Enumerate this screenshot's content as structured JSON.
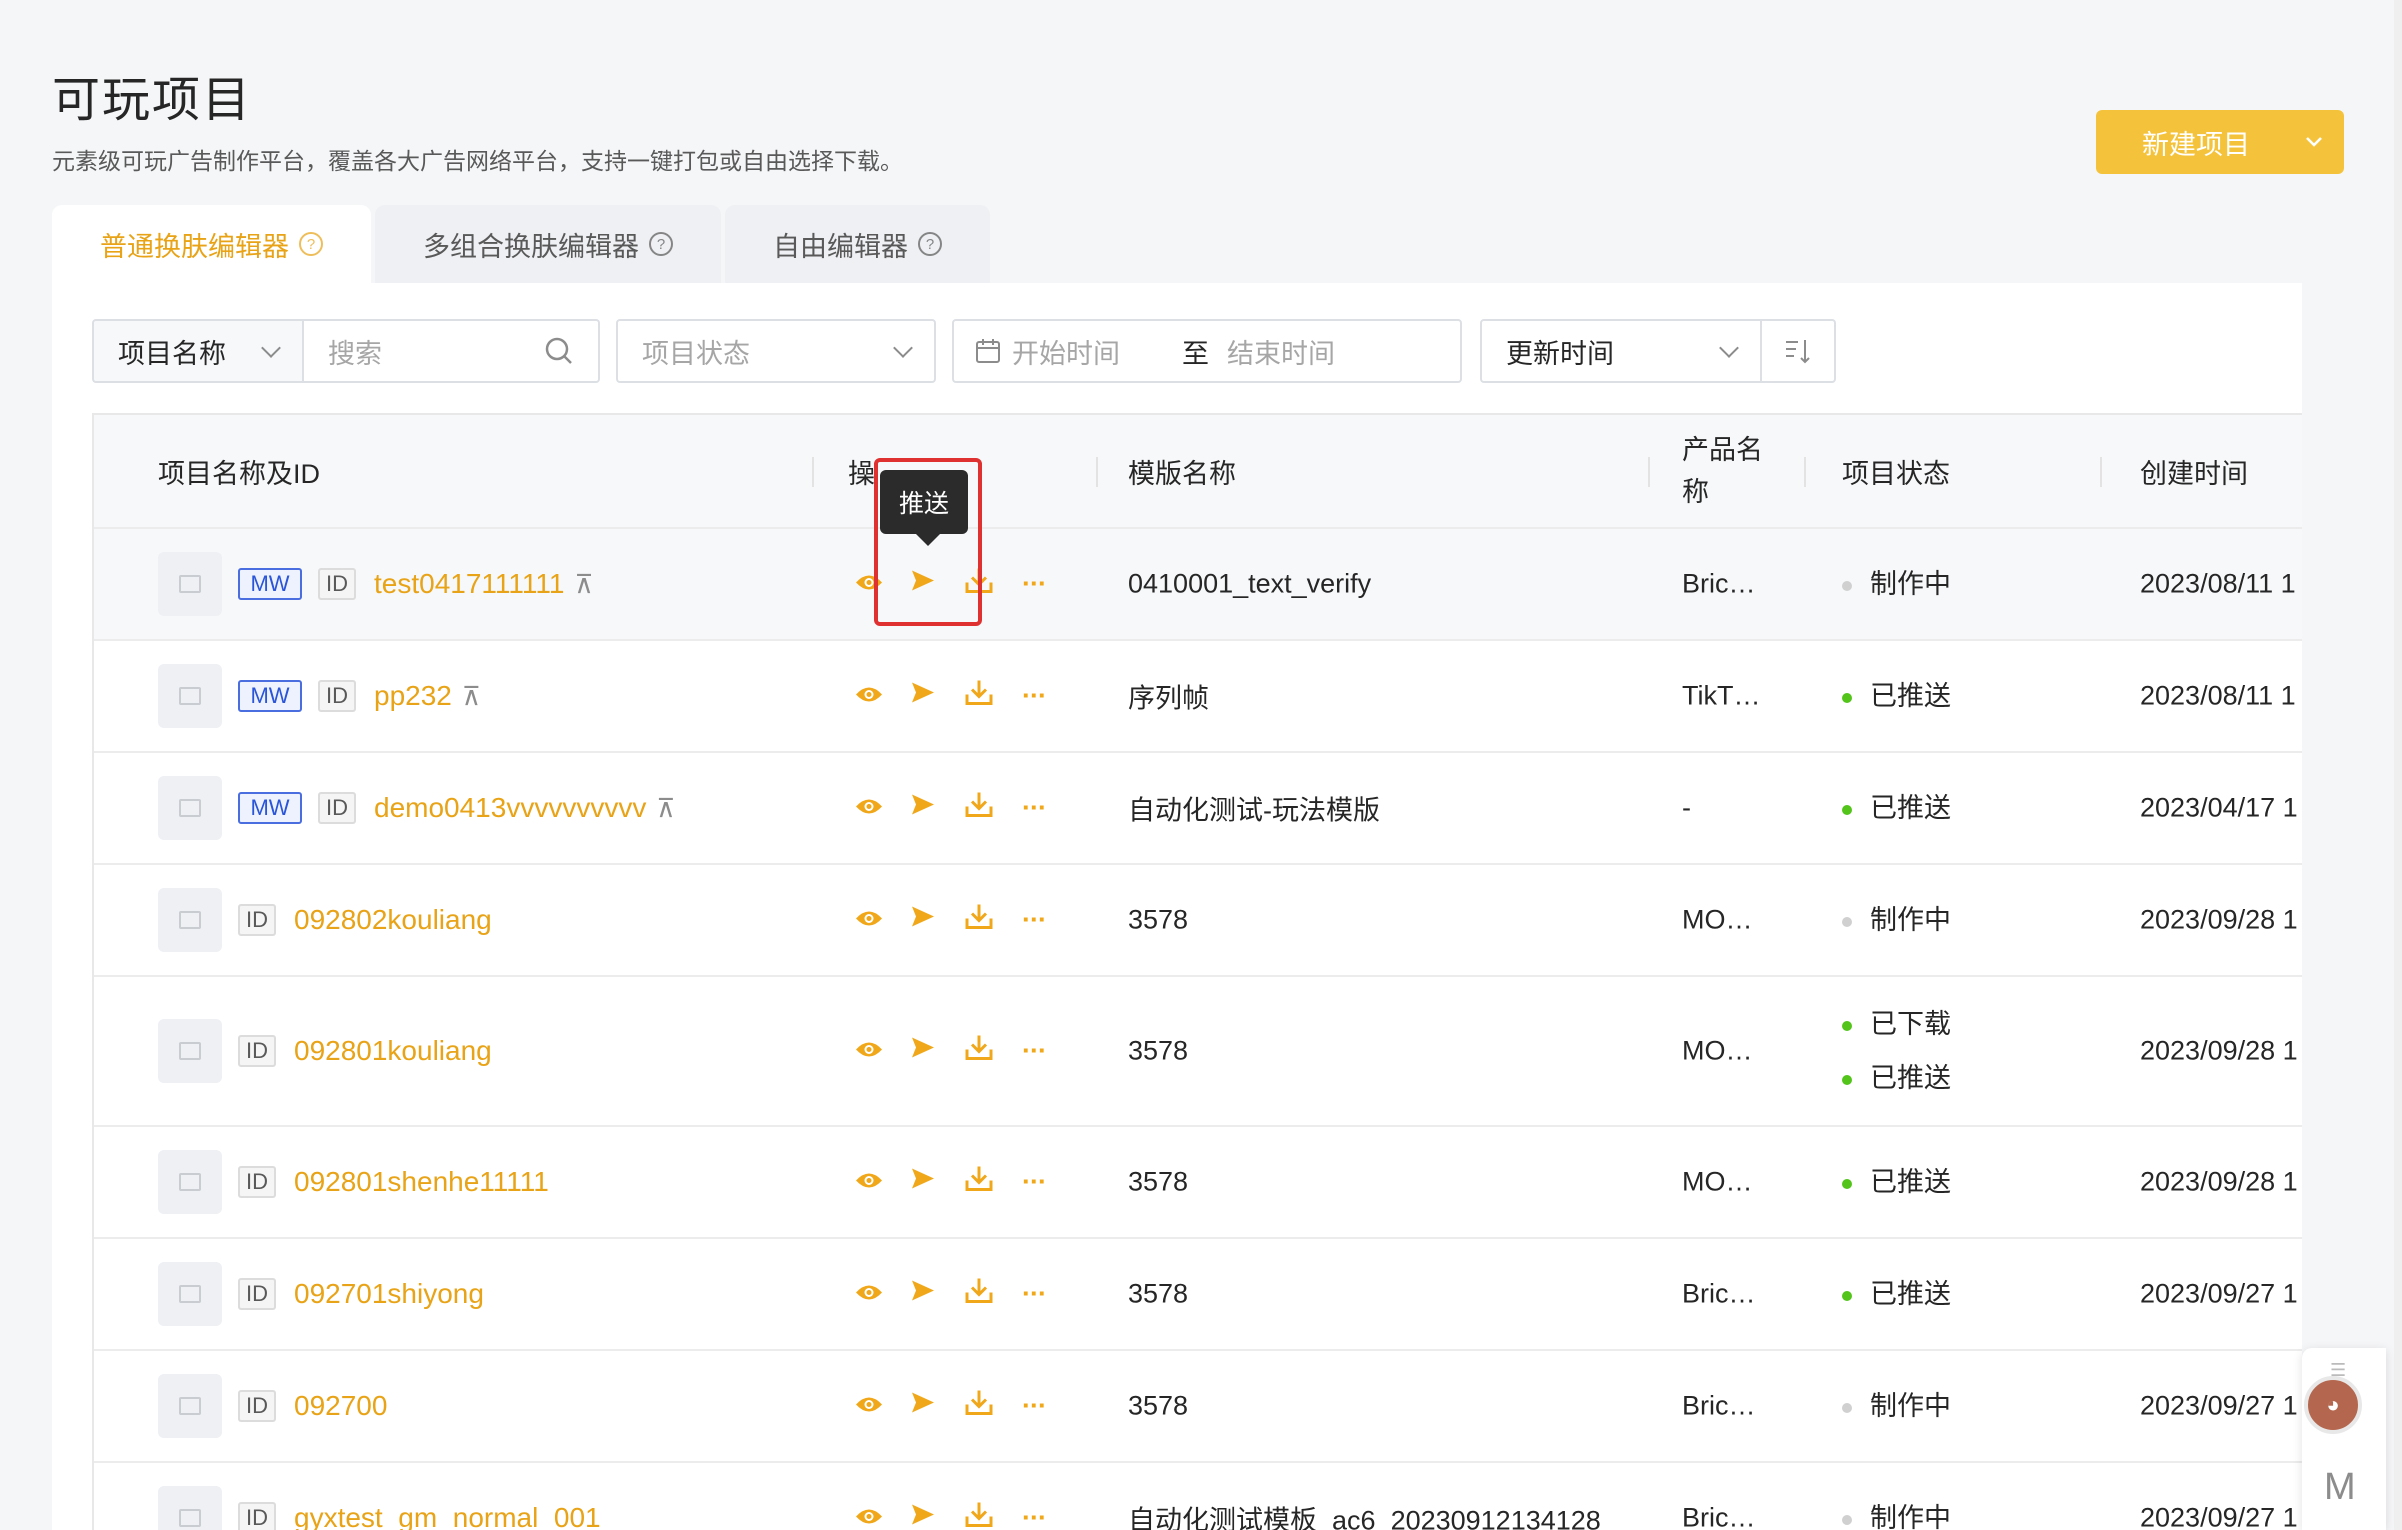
{
  "header": {
    "title": "可玩项目",
    "description": "元素级可玩广告制作平台，覆盖各大广告网络平台，支持一键打包或自由选择下载。",
    "new_button": "新建项目"
  },
  "tabs": [
    {
      "label": "普通换肤编辑器",
      "active": true
    },
    {
      "label": "多组合换肤编辑器",
      "active": false
    },
    {
      "label": "自由编辑器",
      "active": false
    }
  ],
  "filters": {
    "field_select": "项目名称",
    "search_placeholder": "搜索",
    "status_placeholder": "项目状态",
    "start_placeholder": "开始时间",
    "range_sep": "至",
    "end_placeholder": "结束时间",
    "sort_field": "更新时间"
  },
  "columns": {
    "name": "项目名称及ID",
    "ops": "操",
    "template": "模版名称",
    "product": "产品名称",
    "status": "项目状态",
    "created": "创建时间"
  },
  "tooltip": "推送",
  "icons": {
    "id_tag": "ID",
    "mw_tag": "MW",
    "more": "···"
  },
  "rows": [
    {
      "mw": true,
      "name": "test0417111111",
      "pin": true,
      "template": "0410001_text_verify",
      "product": "Bric…",
      "status": [
        {
          "text": "制作中",
          "color": "gray"
        }
      ],
      "created": "2023/08/11 1"
    },
    {
      "mw": true,
      "name": "pp232",
      "pin": true,
      "template": "序列帧",
      "product": "TikT…",
      "status": [
        {
          "text": "已推送",
          "color": "green"
        }
      ],
      "created": "2023/08/11 1"
    },
    {
      "mw": true,
      "name": "demo0413vvvvvvvvvv",
      "pin": true,
      "template": "自动化测试-玩法模版",
      "product": "-",
      "status": [
        {
          "text": "已推送",
          "color": "green"
        }
      ],
      "created": "2023/04/17 1"
    },
    {
      "mw": false,
      "name": "092802kouliang",
      "pin": false,
      "template": "3578",
      "product": "MO…",
      "status": [
        {
          "text": "制作中",
          "color": "gray"
        }
      ],
      "created": "2023/09/28 1"
    },
    {
      "mw": false,
      "name": "092801kouliang",
      "pin": false,
      "template": "3578",
      "product": "MO…",
      "status": [
        {
          "text": "已下载",
          "color": "green"
        },
        {
          "text": "已推送",
          "color": "green"
        }
      ],
      "created": "2023/09/28 1"
    },
    {
      "mw": false,
      "name": "092801shenhe11111",
      "pin": false,
      "template": "3578",
      "product": "MO…",
      "status": [
        {
          "text": "已推送",
          "color": "green"
        }
      ],
      "created": "2023/09/28 1"
    },
    {
      "mw": false,
      "name": "092701shiyong",
      "pin": false,
      "template": "3578",
      "product": "Bric…",
      "status": [
        {
          "text": "已推送",
          "color": "green"
        }
      ],
      "created": "2023/09/27 1"
    },
    {
      "mw": false,
      "name": "092700",
      "pin": false,
      "template": "3578",
      "product": "Bric…",
      "status": [
        {
          "text": "制作中",
          "color": "gray"
        }
      ],
      "created": "2023/09/27 1"
    },
    {
      "mw": false,
      "name": "gyxtest_gm_normal_001",
      "pin": false,
      "template": "自动化测试模板_ac6_20230912134128",
      "product": "Bric…",
      "status": [
        {
          "text": "制作中",
          "color": "gray"
        }
      ],
      "created": "2023/09/27 1"
    }
  ],
  "colors": {
    "accent": "#f5c33b",
    "link": "#e8a317",
    "status_green": "#52c41a",
    "status_gray": "#d0d0d0",
    "highlight": "#e03131"
  }
}
